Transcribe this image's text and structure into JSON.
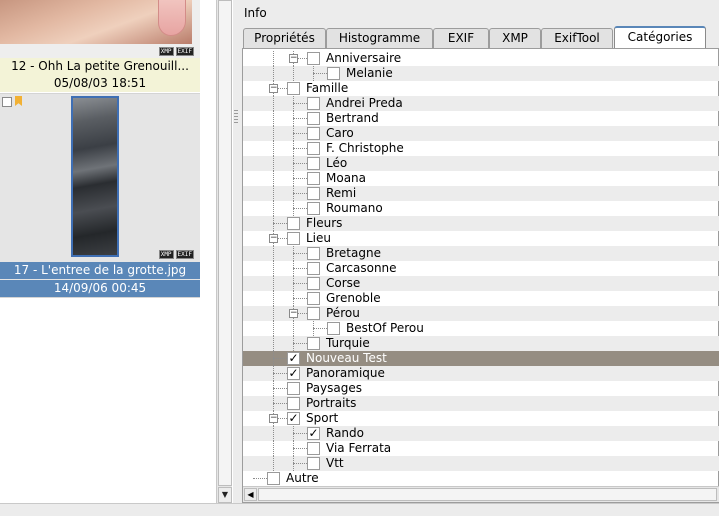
{
  "thumbnails": [
    {
      "name": "12 - Ohh La petite Grenouill...",
      "date": "05/08/03 18:51",
      "badges": [
        "XMP",
        "EXIF"
      ],
      "selected": false
    },
    {
      "name": "17 - L'entree de la grotte.jpg",
      "date": "14/09/06 00:45",
      "badges": [
        "XMP",
        "EXIF"
      ],
      "selected": true
    }
  ],
  "info": {
    "title": "Info",
    "tabs": [
      "Propriétés",
      "Histogramme",
      "EXIF",
      "XMP",
      "ExifTool",
      "Catégories"
    ],
    "active_tab": "Catégories"
  },
  "tree": [
    {
      "label": "Anniversaire",
      "level": 2,
      "expander": "minus",
      "checked": false
    },
    {
      "label": "Melanie",
      "level": 3,
      "expander": null,
      "checked": false
    },
    {
      "label": "Famille",
      "level": 1,
      "expander": "minus",
      "checked": false
    },
    {
      "label": "Andrei Preda",
      "level": 2,
      "expander": null,
      "checked": false
    },
    {
      "label": "Bertrand",
      "level": 2,
      "expander": null,
      "checked": false
    },
    {
      "label": "Caro",
      "level": 2,
      "expander": null,
      "checked": false
    },
    {
      "label": "F. Christophe",
      "level": 2,
      "expander": null,
      "checked": false
    },
    {
      "label": "Léo",
      "level": 2,
      "expander": null,
      "checked": false
    },
    {
      "label": "Moana",
      "level": 2,
      "expander": null,
      "checked": false
    },
    {
      "label": "Remi",
      "level": 2,
      "expander": null,
      "checked": false
    },
    {
      "label": "Roumano",
      "level": 2,
      "expander": null,
      "checked": false
    },
    {
      "label": "Fleurs",
      "level": 1,
      "expander": null,
      "checked": false
    },
    {
      "label": "Lieu",
      "level": 1,
      "expander": "minus",
      "checked": false
    },
    {
      "label": "Bretagne",
      "level": 2,
      "expander": null,
      "checked": false
    },
    {
      "label": "Carcasonne",
      "level": 2,
      "expander": null,
      "checked": false
    },
    {
      "label": "Corse",
      "level": 2,
      "expander": null,
      "checked": false
    },
    {
      "label": "Grenoble",
      "level": 2,
      "expander": null,
      "checked": false
    },
    {
      "label": "Pérou",
      "level": 2,
      "expander": "minus",
      "checked": false
    },
    {
      "label": "BestOf Perou",
      "level": 3,
      "expander": null,
      "checked": false
    },
    {
      "label": "Turquie",
      "level": 2,
      "expander": null,
      "checked": false
    },
    {
      "label": "Nouveau Test",
      "level": 1,
      "expander": null,
      "checked": true,
      "selected": true
    },
    {
      "label": "Panoramique",
      "level": 1,
      "expander": null,
      "checked": true
    },
    {
      "label": "Paysages",
      "level": 1,
      "expander": null,
      "checked": false
    },
    {
      "label": "Portraits",
      "level": 1,
      "expander": null,
      "checked": false
    },
    {
      "label": "Sport",
      "level": 1,
      "expander": "minus",
      "checked": true
    },
    {
      "label": "Rando",
      "level": 2,
      "expander": null,
      "checked": true
    },
    {
      "label": "Via Ferrata",
      "level": 2,
      "expander": null,
      "checked": false
    },
    {
      "label": "Vtt",
      "level": 2,
      "expander": null,
      "checked": false
    },
    {
      "label": "Autre",
      "level": 0,
      "expander": null,
      "checked": false
    }
  ],
  "icons": {
    "check": "check-mark",
    "expander": "minus-box",
    "scroll_down": "arrow-down",
    "scroll_left": "arrow-left"
  }
}
